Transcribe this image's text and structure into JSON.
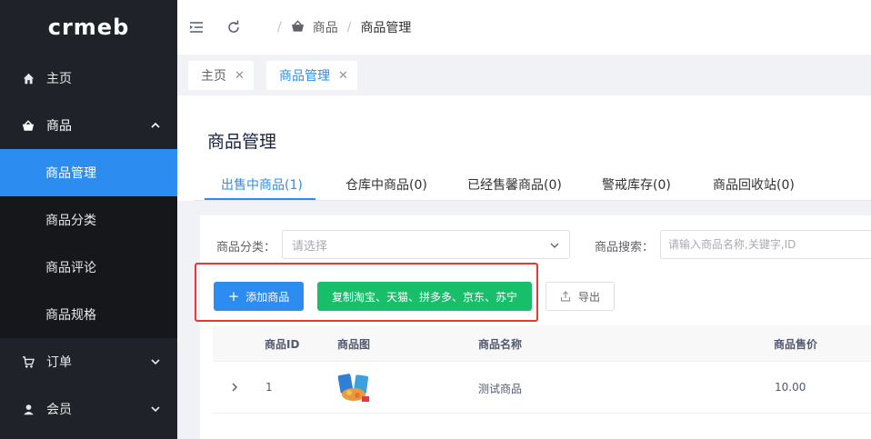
{
  "logo": "crmeb",
  "sidebar": {
    "home": "主页",
    "product": "商品",
    "product_children": [
      "商品管理",
      "商品分类",
      "商品评论",
      "商品规格"
    ],
    "order": "订单",
    "member": "会员"
  },
  "header": {
    "breadcrumb": [
      "商品",
      "商品管理"
    ]
  },
  "tags": [
    {
      "label": "主页",
      "close": "✕"
    },
    {
      "label": "商品管理",
      "close": "✕"
    }
  ],
  "page": {
    "title": "商品管理",
    "tabs": [
      "出售中商品(1)",
      "仓库中商品(0)",
      "已经售馨商品(0)",
      "警戒库存(0)",
      "商品回收站(0)"
    ]
  },
  "filters": {
    "category_label": "商品分类：",
    "category_placeholder": "请选择",
    "search_label": "商品搜索：",
    "search_placeholder": "请输入商品名称,关键字,ID"
  },
  "toolbar": {
    "add_plus": "+",
    "add_label": "添加商品",
    "copy_label": "复制淘宝、天猫、拼多多、京东、苏宁",
    "export_label": "导出"
  },
  "table": {
    "columns": [
      "商品ID",
      "商品图",
      "商品名称",
      "商品售价"
    ],
    "rows": [
      {
        "id": "1",
        "name": "测试商品",
        "price": "10.00"
      }
    ]
  },
  "colors": {
    "primary": "#2d8cf0",
    "success": "#19be6b",
    "sidebar_bg": "#1f2329",
    "highlight": "#e53935"
  }
}
